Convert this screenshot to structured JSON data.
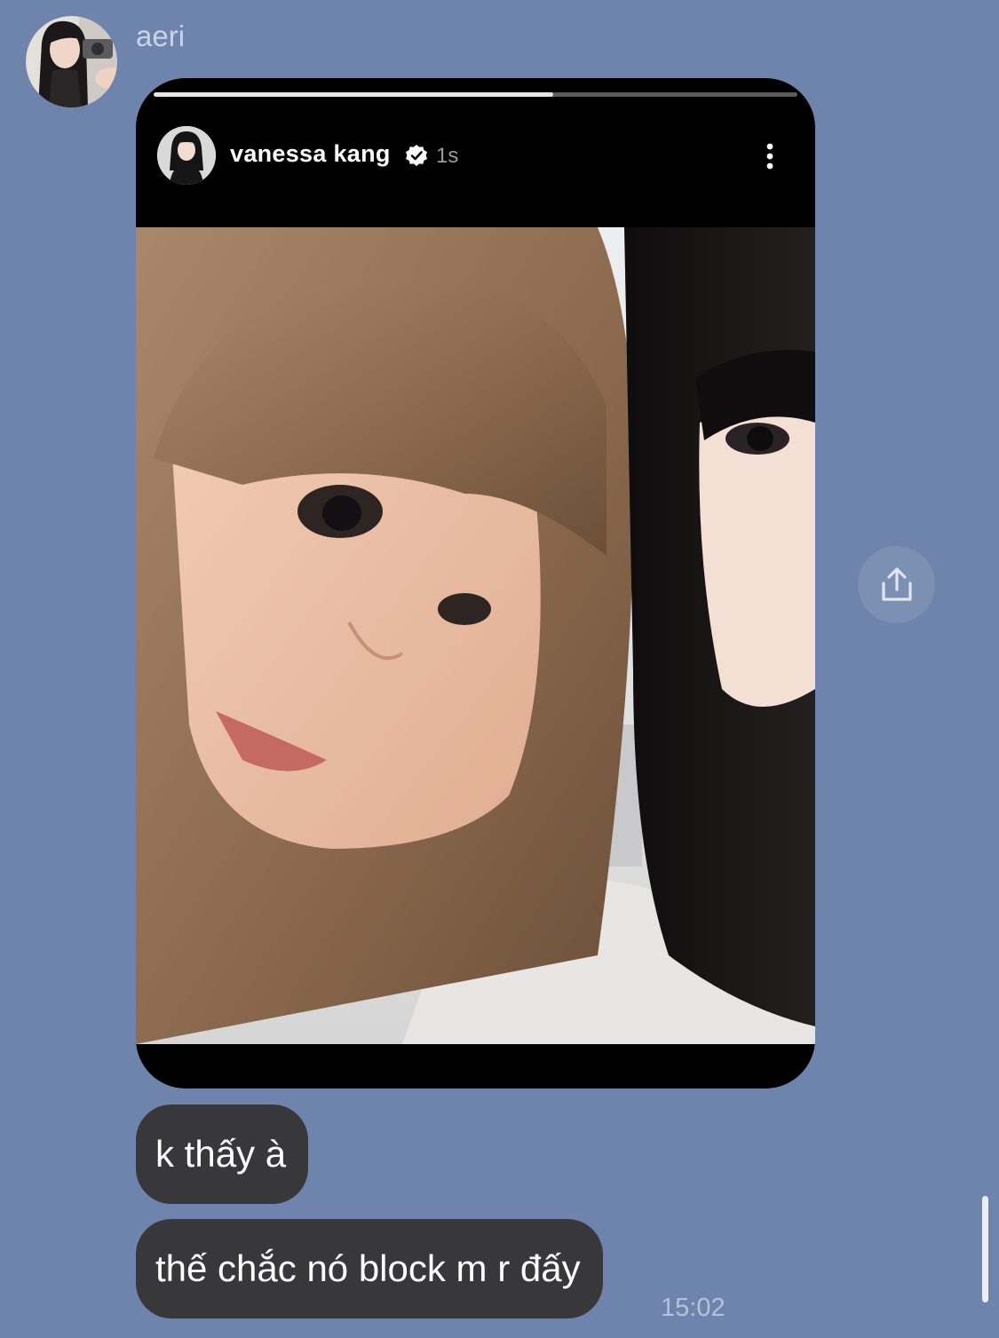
{
  "thread": {
    "sender_name": "aeri",
    "sender_avatar_icon": "profile-photo"
  },
  "story": {
    "username": "vanessa kang",
    "verified": true,
    "timestamp": "1s",
    "progress": 0.62,
    "menu_icon": "more-vertical-icon",
    "photo_desc": "selfie-photo"
  },
  "actions": {
    "share_icon": "share-icon"
  },
  "messages": [
    {
      "text": "k thấy à"
    },
    {
      "text": "thế chắc nó block m r đấy"
    }
  ],
  "last_timestamp": "15:02",
  "colors": {
    "background": "#6e84ac",
    "bubble": "#38383b",
    "story_bg": "#000000"
  }
}
